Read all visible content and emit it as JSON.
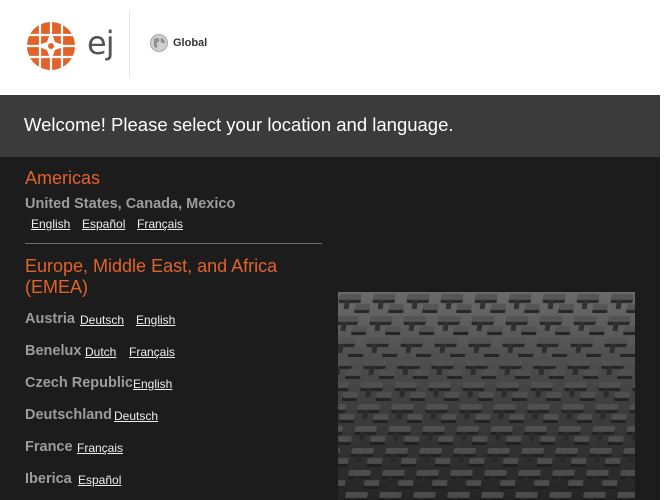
{
  "header": {
    "logo_text": "ej",
    "region_label": "Global",
    "icons": {
      "logo": "ej-compass-logo-icon",
      "globe": "globe-icon"
    },
    "colors": {
      "logo": "#e2632a"
    }
  },
  "welcome": {
    "title": "Welcome! Please select your location and language."
  },
  "regions": [
    {
      "title": "Americas",
      "countries": [
        {
          "name": "United States, Canada, Mexico",
          "languages": [
            "English",
            "Español",
            "Français"
          ]
        }
      ]
    },
    {
      "title_line1": "Europe, Middle East, and Africa",
      "title_line2": "(EMEA)",
      "countries": [
        {
          "name": "Austria",
          "languages": [
            "Deutsch",
            "English"
          ]
        },
        {
          "name": "Benelux",
          "languages": [
            "Dutch",
            "Français"
          ]
        },
        {
          "name": "Czech Republic",
          "languages": [
            "English"
          ]
        },
        {
          "name": "Deutschland",
          "languages": [
            "Deutsch"
          ]
        },
        {
          "name": "France",
          "languages": [
            "Français"
          ]
        },
        {
          "name": "Iberica",
          "languages": [
            "Español"
          ]
        }
      ]
    }
  ],
  "colors": {
    "accent": "#e2632a",
    "welcome_bg": "#3b3b3b",
    "main_bg": "#1c1c1c"
  }
}
